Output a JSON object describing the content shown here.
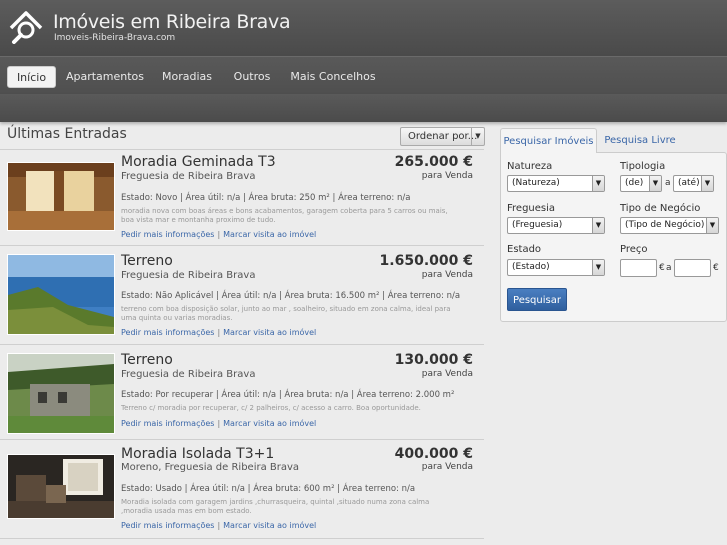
{
  "header": {
    "title": "Imóveis em Ribeira Brava",
    "url": "Imoveis-Ribeira-Brava.com",
    "logo_icon": "house-search-icon"
  },
  "nav": {
    "items": [
      {
        "label": "Início",
        "active": true
      },
      {
        "label": "Apartamentos",
        "active": false
      },
      {
        "label": "Moradias",
        "active": false
      },
      {
        "label": "Outros",
        "active": false
      },
      {
        "label": "Mais Concelhos",
        "active": false
      }
    ]
  },
  "main": {
    "title": "Últimas Entradas",
    "sort_label": "Ordenar por...",
    "listings": [
      {
        "title": "Moradia Geminada  T3",
        "location": "Freguesia de Ribeira Brava",
        "price": "265.000 €",
        "deal": "para Venda",
        "specs": "Estado: Novo  | Área útil: n/a  | Área bruta: 250 m²  | Área terreno: n/a",
        "description": "moradia nova com boas áreas e bons acabamentos, garagem coberta para 5 carros ou mais, boa vista mar e montanha proximo de tudo.",
        "link_info": "Pedir mais informações",
        "link_visit": "Marcar visita ao imóvel",
        "photo": "interior-room"
      },
      {
        "title": "Terreno",
        "location": "Freguesia de Ribeira Brava",
        "price": "1.650.000 €",
        "deal": "para Venda",
        "specs": "Estado: Não Aplicável  | Área útil: n/a  | Área bruta: 16.500 m²  | Área terreno: n/a",
        "description": "terreno com boa disposição solar, junto ao mar , soalheiro, situado em zona calma, ideal para uma quinta ou varias moradias.",
        "link_info": "Pedir mais informações",
        "link_visit": "Marcar visita ao imóvel",
        "photo": "sea-cliff"
      },
      {
        "title": "Terreno",
        "location": "Freguesia de Ribeira Brava",
        "price": "130.000 €",
        "deal": "para Venda",
        "specs": "Estado: Por recuperar  | Área útil: n/a  | Área bruta: n/a  | Área terreno: 2.000 m²",
        "description": "Terreno c/ moradia por recuperar, c/ 2 palheiros, c/ acesso a carro. Boa oportunidade.",
        "link_info": "Pedir mais informações",
        "link_visit": "Marcar visita ao imóvel",
        "photo": "old-stone-house"
      },
      {
        "title": "Moradia Isolada  T3+1",
        "location": "Moreno, Freguesia de Ribeira Brava",
        "price": "400.000 €",
        "deal": "para Venda",
        "specs": "Estado: Usado  | Área útil: n/a  | Área bruta: 600 m²  | Área terreno: n/a",
        "description": "Moradia isolada com garagem jardins ,churrasqueira, quintal ,situado numa zona calma ,moradia usada mas em bom estado.",
        "link_info": "Pedir mais informações",
        "link_visit": "Marcar visita ao imóvel",
        "photo": "living-room"
      }
    ]
  },
  "search": {
    "tab_active": "Pesquisar Imóveis",
    "tab_other": "Pesquisa Livre",
    "natureza_label": "Natureza",
    "natureza_value": "(Natureza)",
    "tipologia_label": "Tipologia",
    "tipologia_from": "(de)",
    "tipologia_sep": "a",
    "tipologia_to": "(até)",
    "freguesia_label": "Freguesia",
    "freguesia_value": "(Freguesia)",
    "negocio_label": "Tipo de Negócio",
    "negocio_value": "(Tipo de Negócio)",
    "estado_label": "Estado",
    "estado_value": "(Estado)",
    "preco_label": "Preço",
    "preco_sep": "a",
    "currency": "€",
    "button_label": "Pesquisar"
  },
  "colors": {
    "header_bg": "#4f4f4f",
    "link": "#3b67a8",
    "button": "#3a6dae"
  }
}
